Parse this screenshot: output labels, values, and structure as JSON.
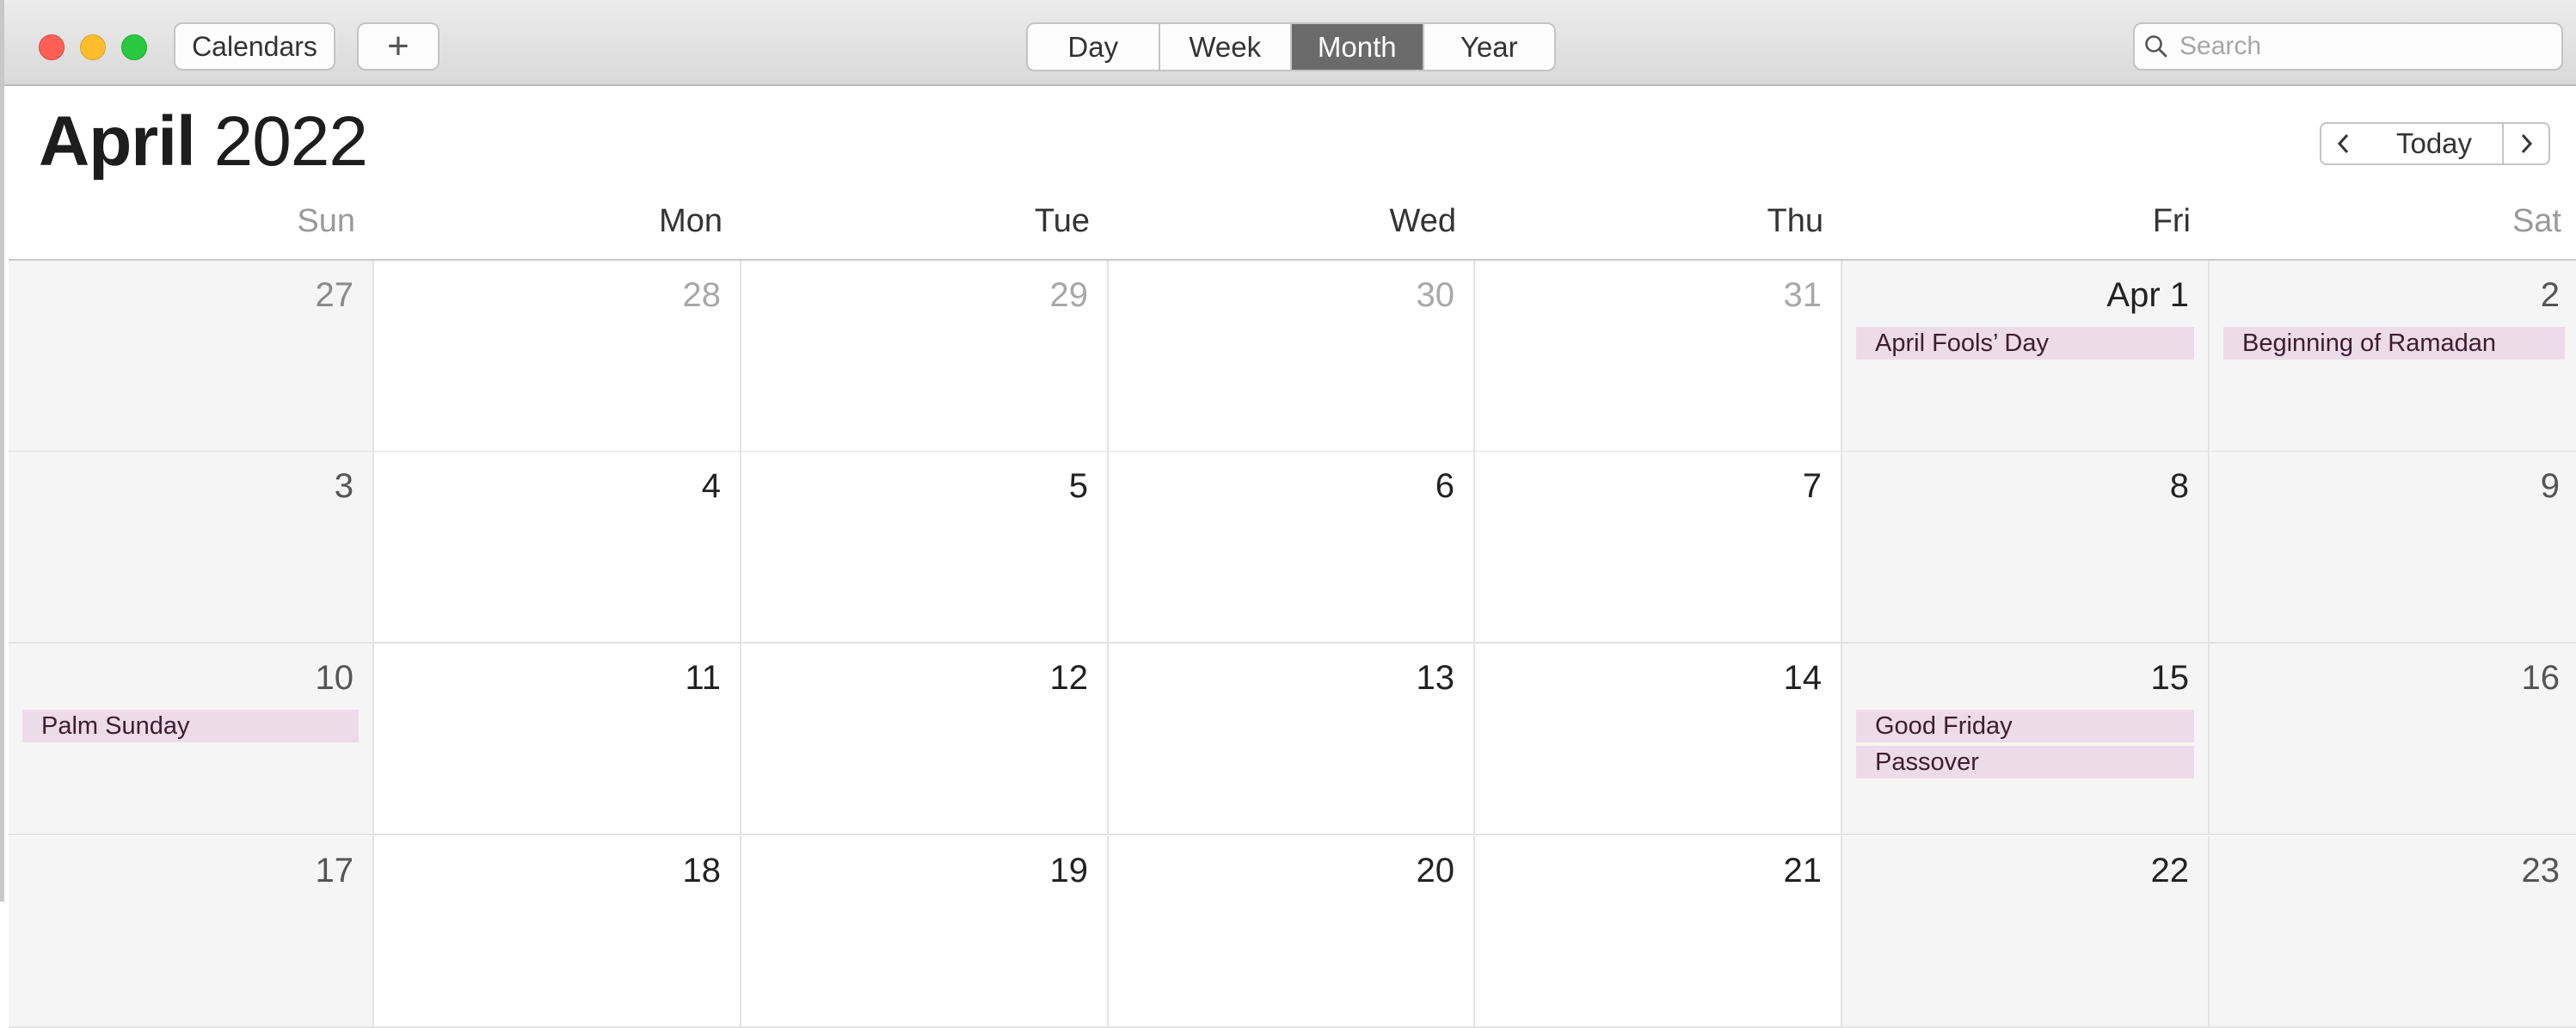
{
  "toolbar": {
    "calendars_label": "Calendars",
    "add_label": "+",
    "views": [
      "Day",
      "Week",
      "Month",
      "Year"
    ],
    "active_view": "Month",
    "search_placeholder": "Search"
  },
  "header": {
    "month": "April",
    "year": "2022",
    "today_label": "Today",
    "prev_label": "‹",
    "next_label": "›"
  },
  "weekdays": [
    "Sun",
    "Mon",
    "Tue",
    "Wed",
    "Thu",
    "Fri",
    "Sat"
  ],
  "weeks": [
    [
      {
        "label": "27",
        "other": true
      },
      {
        "label": "28",
        "other": true
      },
      {
        "label": "29",
        "other": true
      },
      {
        "label": "30",
        "other": true
      },
      {
        "label": "31",
        "other": true
      },
      {
        "label": "Apr 1",
        "events": [
          "April Fools’ Day"
        ]
      },
      {
        "label": "2",
        "events": [
          "Beginning of Ramadan"
        ]
      }
    ],
    [
      {
        "label": "3"
      },
      {
        "label": "4"
      },
      {
        "label": "5"
      },
      {
        "label": "6"
      },
      {
        "label": "7"
      },
      {
        "label": "8"
      },
      {
        "label": "9"
      }
    ],
    [
      {
        "label": "10",
        "events": [
          "Palm Sunday"
        ]
      },
      {
        "label": "11"
      },
      {
        "label": "12"
      },
      {
        "label": "13"
      },
      {
        "label": "14"
      },
      {
        "label": "15",
        "events": [
          "Good Friday",
          "Passover"
        ]
      },
      {
        "label": "16"
      }
    ],
    [
      {
        "label": "17"
      },
      {
        "label": "18"
      },
      {
        "label": "19"
      },
      {
        "label": "20"
      },
      {
        "label": "21"
      },
      {
        "label": "22"
      },
      {
        "label": "23"
      }
    ]
  ],
  "colors": {
    "event_bg": "#eedbe9",
    "active_segment": "#6b6b6b",
    "weekend_bg": "#f5f5f5"
  }
}
